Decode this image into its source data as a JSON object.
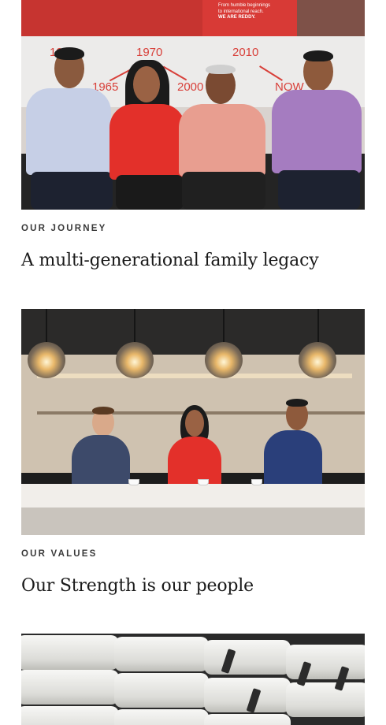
{
  "cards": [
    {
      "eyebrow": "OUR JOURNEY",
      "title": "A multi-generational family legacy",
      "photo": {
        "banner_lines": [
          "From humble beginnings",
          "to international reach.",
          "WE ARE REDDY."
        ],
        "years": [
          "1960",
          "1970",
          "2010",
          "1965",
          "2000",
          "NOW"
        ]
      }
    },
    {
      "eyebrow": "OUR VALUES",
      "title": "Our Strength is our people"
    }
  ],
  "colors": {
    "accent_red": "#d83a36",
    "text_dark": "#1a1a1a",
    "eyebrow_gray": "#3a3a3a",
    "background": "#ffffff"
  }
}
